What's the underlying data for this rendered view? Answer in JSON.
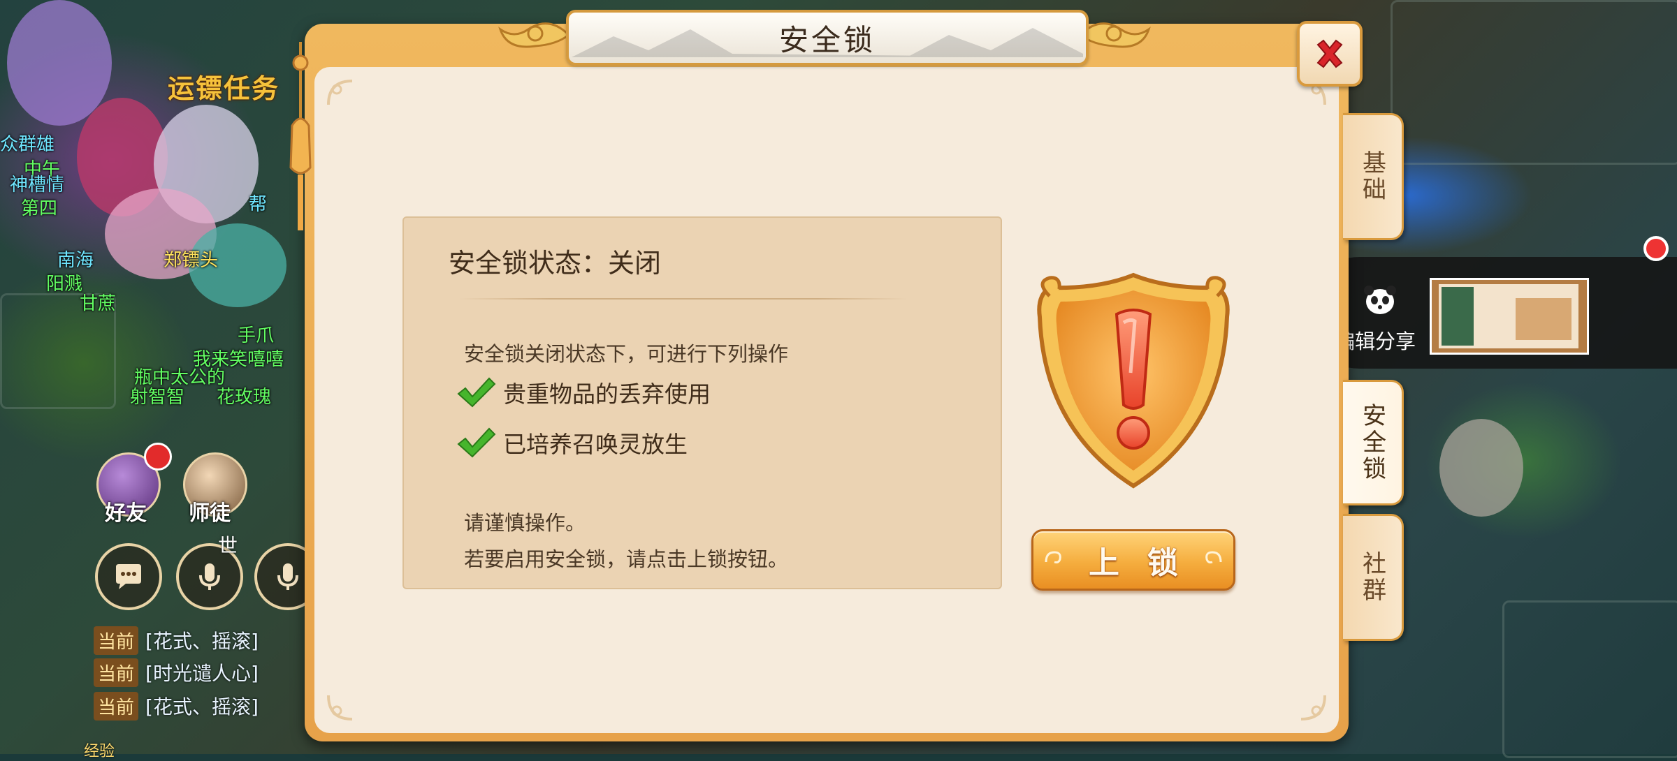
{
  "game": {
    "quest_label": "运镖任务",
    "name_tags": [
      {
        "text": "众群雄",
        "style": "cyan"
      },
      {
        "text": "中午",
        "style": "green"
      },
      {
        "text": "神槽情",
        "style": "cyan"
      },
      {
        "text": "第四",
        "style": "green"
      },
      {
        "text": "帮",
        "style": "cyan"
      },
      {
        "text": "南海",
        "style": "cyan"
      },
      {
        "text": "郑镖头",
        "style": "yellow"
      },
      {
        "text": "阳溅",
        "style": "green"
      },
      {
        "text": "甘蔗",
        "style": "green"
      },
      {
        "text": "手爪",
        "style": "green"
      },
      {
        "text": "我来笑嘻嘻",
        "style": "green"
      },
      {
        "text": "瓶中太公的",
        "style": "green"
      },
      {
        "text": "射智智",
        "style": "green"
      },
      {
        "text": "花玫瑰",
        "style": "green"
      }
    ],
    "friends_label": "好友",
    "mentor_label": "师徒",
    "world_label": "世",
    "chat": [
      {
        "channel": "当前",
        "message": "[花式、摇滚]"
      },
      {
        "channel": "当前",
        "message": "[时光谴人心]"
      },
      {
        "channel": "当前",
        "message": "[花式、摇滚]"
      }
    ],
    "exp_label": "经验"
  },
  "dialog": {
    "title": "安全锁",
    "status_heading": "安全锁状态：关闭",
    "description": "安全锁关闭状态下，可进行下列操作",
    "permissions": [
      "贵重物品的丢弃使用",
      "已培养召唤灵放生"
    ],
    "notice_line1": "请谨慎操作。",
    "notice_line2": "若要启用安全锁，请点击上锁按钮。",
    "lock_button_label": "上锁"
  },
  "tabs": [
    {
      "label": "基础",
      "active": false
    },
    {
      "label": "安全锁",
      "active": true
    },
    {
      "label": "社群",
      "active": false
    }
  ],
  "share": {
    "label": "编辑分享"
  },
  "colors": {
    "panel_orange": "#e7a24a",
    "panel_cream": "#f6ebdc",
    "content_tan": "#ebd3b3",
    "check_green": "#46b52c",
    "close_red": "#d9252a",
    "button_orange": "#f5ad3e"
  }
}
